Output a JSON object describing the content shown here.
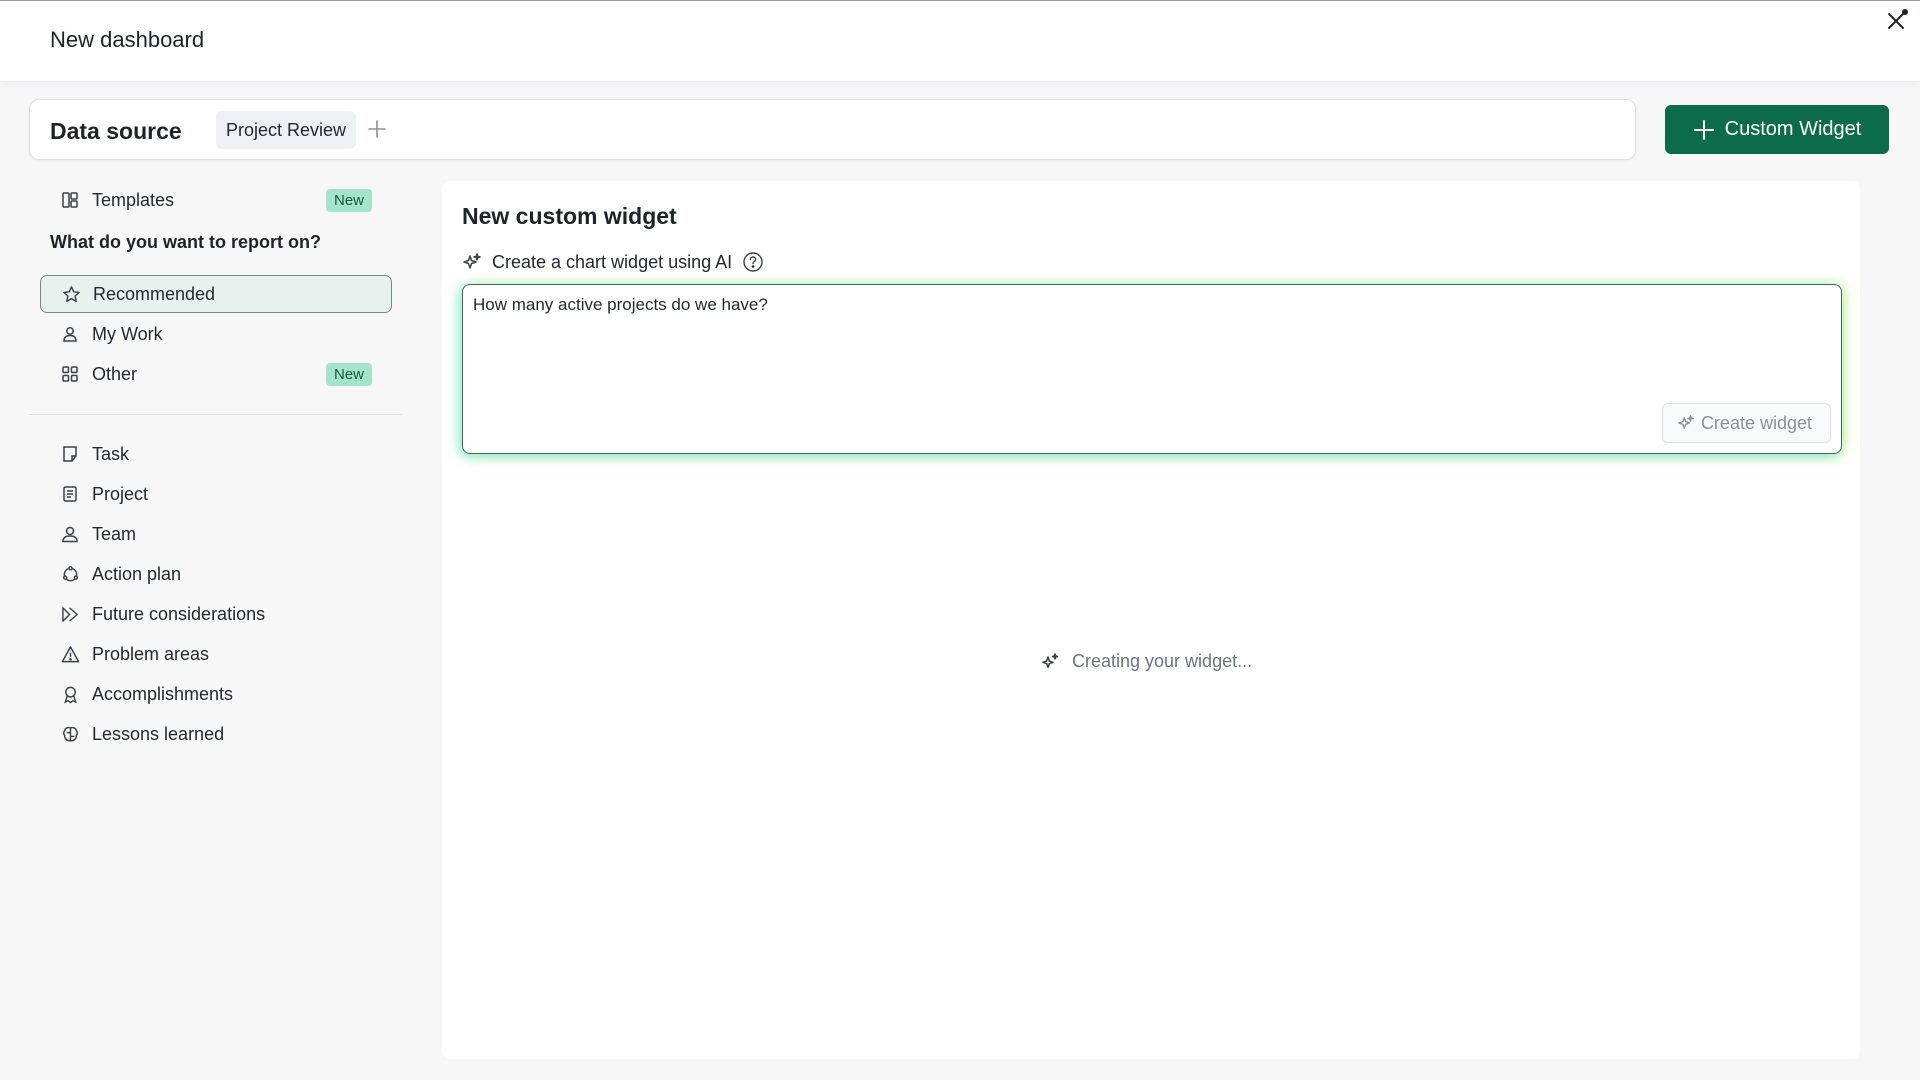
{
  "header": {
    "title": "New dashboard",
    "close_icon": "close-icon"
  },
  "data_source": {
    "label": "Data source",
    "chip": "Project Review",
    "add_icon": "plus-icon"
  },
  "custom_widget_button": {
    "label": "Custom Widget",
    "icon": "plus-icon"
  },
  "sidebar": {
    "templates": {
      "label": "Templates",
      "badge": "New",
      "icon": "template-grid-icon"
    },
    "heading": "What do you want to report on?",
    "report_items": [
      {
        "label": "Recommended",
        "icon": "star-icon",
        "active": true
      },
      {
        "label": "My Work",
        "icon": "person-icon"
      },
      {
        "label": "Other",
        "icon": "grid-icon",
        "badge": "New"
      }
    ],
    "entity_items": [
      {
        "label": "Task",
        "icon": "task-icon"
      },
      {
        "label": "Project",
        "icon": "project-icon"
      },
      {
        "label": "Team",
        "icon": "team-icon"
      },
      {
        "label": "Action plan",
        "icon": "action-plan-icon"
      },
      {
        "label": "Future considerations",
        "icon": "future-icon"
      },
      {
        "label": "Problem areas",
        "icon": "warning-icon"
      },
      {
        "label": "Accomplishments",
        "icon": "award-icon"
      },
      {
        "label": "Lessons learned",
        "icon": "brain-icon"
      }
    ]
  },
  "main": {
    "title": "New custom widget",
    "ai_label": "Create a chart widget using AI",
    "prompt_value": "How many active projects do we have?",
    "create_button": "Create widget",
    "loading_text": "Creating your widget..."
  },
  "colors": {
    "accent": "#0b6b4b",
    "badge_bg": "#a6e3cd",
    "active_bg": "#e8f1ee"
  }
}
